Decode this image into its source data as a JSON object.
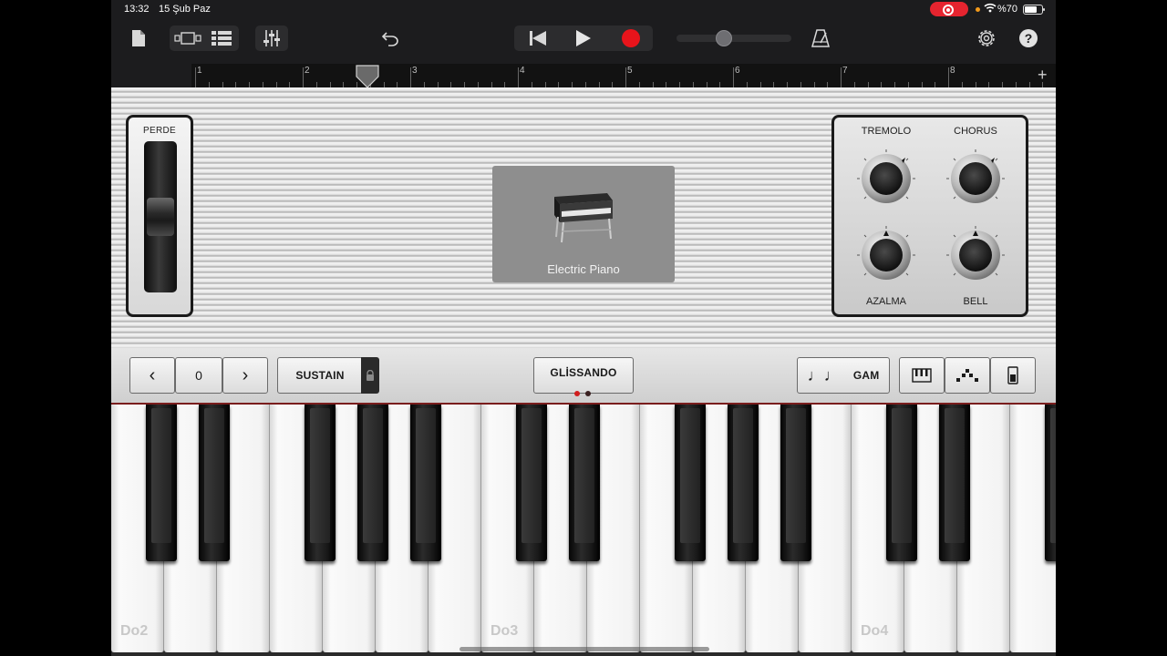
{
  "status_bar": {
    "time": "13:32",
    "date": "15 Şub Paz",
    "battery": "%70",
    "battery_level": 0.7
  },
  "toolbar": {
    "icons": [
      "document-icon",
      "view-toggle-icon",
      "tracks-icon",
      "mixer-icon",
      "undo-icon",
      "go-to-start-icon",
      "play-icon",
      "record-icon",
      "volume-slider",
      "metronome-icon",
      "settings-icon",
      "help-icon"
    ],
    "volume_level": 0.4,
    "accent_record": "#e8141b"
  },
  "ruler": {
    "bars": [
      "1",
      "2",
      "3",
      "4",
      "5",
      "6",
      "7",
      "8"
    ],
    "add_label": "+"
  },
  "instrument": {
    "pitch_label": "PERDE",
    "name": "Electric Piano",
    "knobs": {
      "tremolo": "TREMOLO",
      "chorus": "CHORUS",
      "decay": "AZALMA",
      "bell": "BELL"
    }
  },
  "controls": {
    "octave_prev": "‹",
    "octave_value": "0",
    "octave_next": "›",
    "sustain": "SUSTAIN",
    "glissando": "GLİSSANDO",
    "scale": "GAM",
    "scale_icon": "♩♩"
  },
  "keyboard": {
    "labels": [
      "Do2",
      "Do3",
      "Do4"
    ]
  }
}
